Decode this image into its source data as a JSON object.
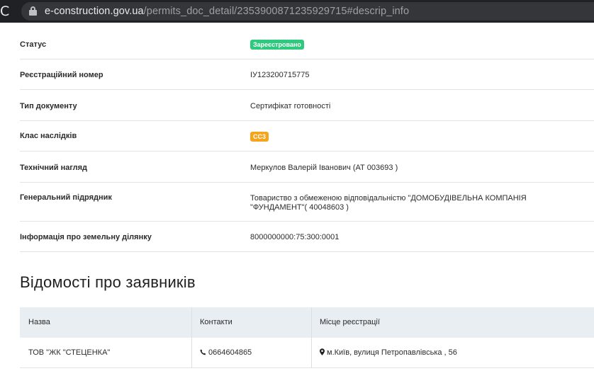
{
  "browser": {
    "url_host": "e-construction.gov.ua",
    "url_path": "/permits_doc_detail/2353900871235929715#descrip_info"
  },
  "details": [
    {
      "label": "Статус",
      "value": "Зареєстровано",
      "kind": "badge",
      "badge_color": "#2ec97c"
    },
    {
      "label": "Реєстраційний номер",
      "value": "IУ123200715775",
      "kind": "text"
    },
    {
      "label": "Тип документу",
      "value": "Сертифікат готовності",
      "kind": "text"
    },
    {
      "label": "Клас наслідків",
      "value": "СС3",
      "kind": "badge",
      "badge_color": "#f4a51c"
    },
    {
      "label": "Технічний нагляд",
      "value": "Меркулов Валерій Іванович (АТ 003693 )",
      "kind": "text"
    },
    {
      "label": "Генеральний підрядник",
      "value_line1": "Товариство з обмеженою відповідальністю \"ДОМОБУДІВЕЛЬНА КОМПАНІЯ",
      "value_line2": "\"ФУНДАМЕНТ\"( 40048603 )",
      "kind": "multiline"
    },
    {
      "label": "Інформація про земельну ділянку",
      "value": "8000000000:75:300:0001",
      "kind": "text"
    }
  ],
  "applicants": {
    "title": "Відомості про заявників",
    "columns": [
      "Назва",
      "Контакти",
      "Місце реєстрації"
    ],
    "rows": [
      {
        "name": "ТОВ \"ЖК \"СТЕЦЕНКА\"",
        "phone": "0664604865",
        "address": "м.Київ, вулиця Петропавлівська , 56"
      }
    ]
  }
}
